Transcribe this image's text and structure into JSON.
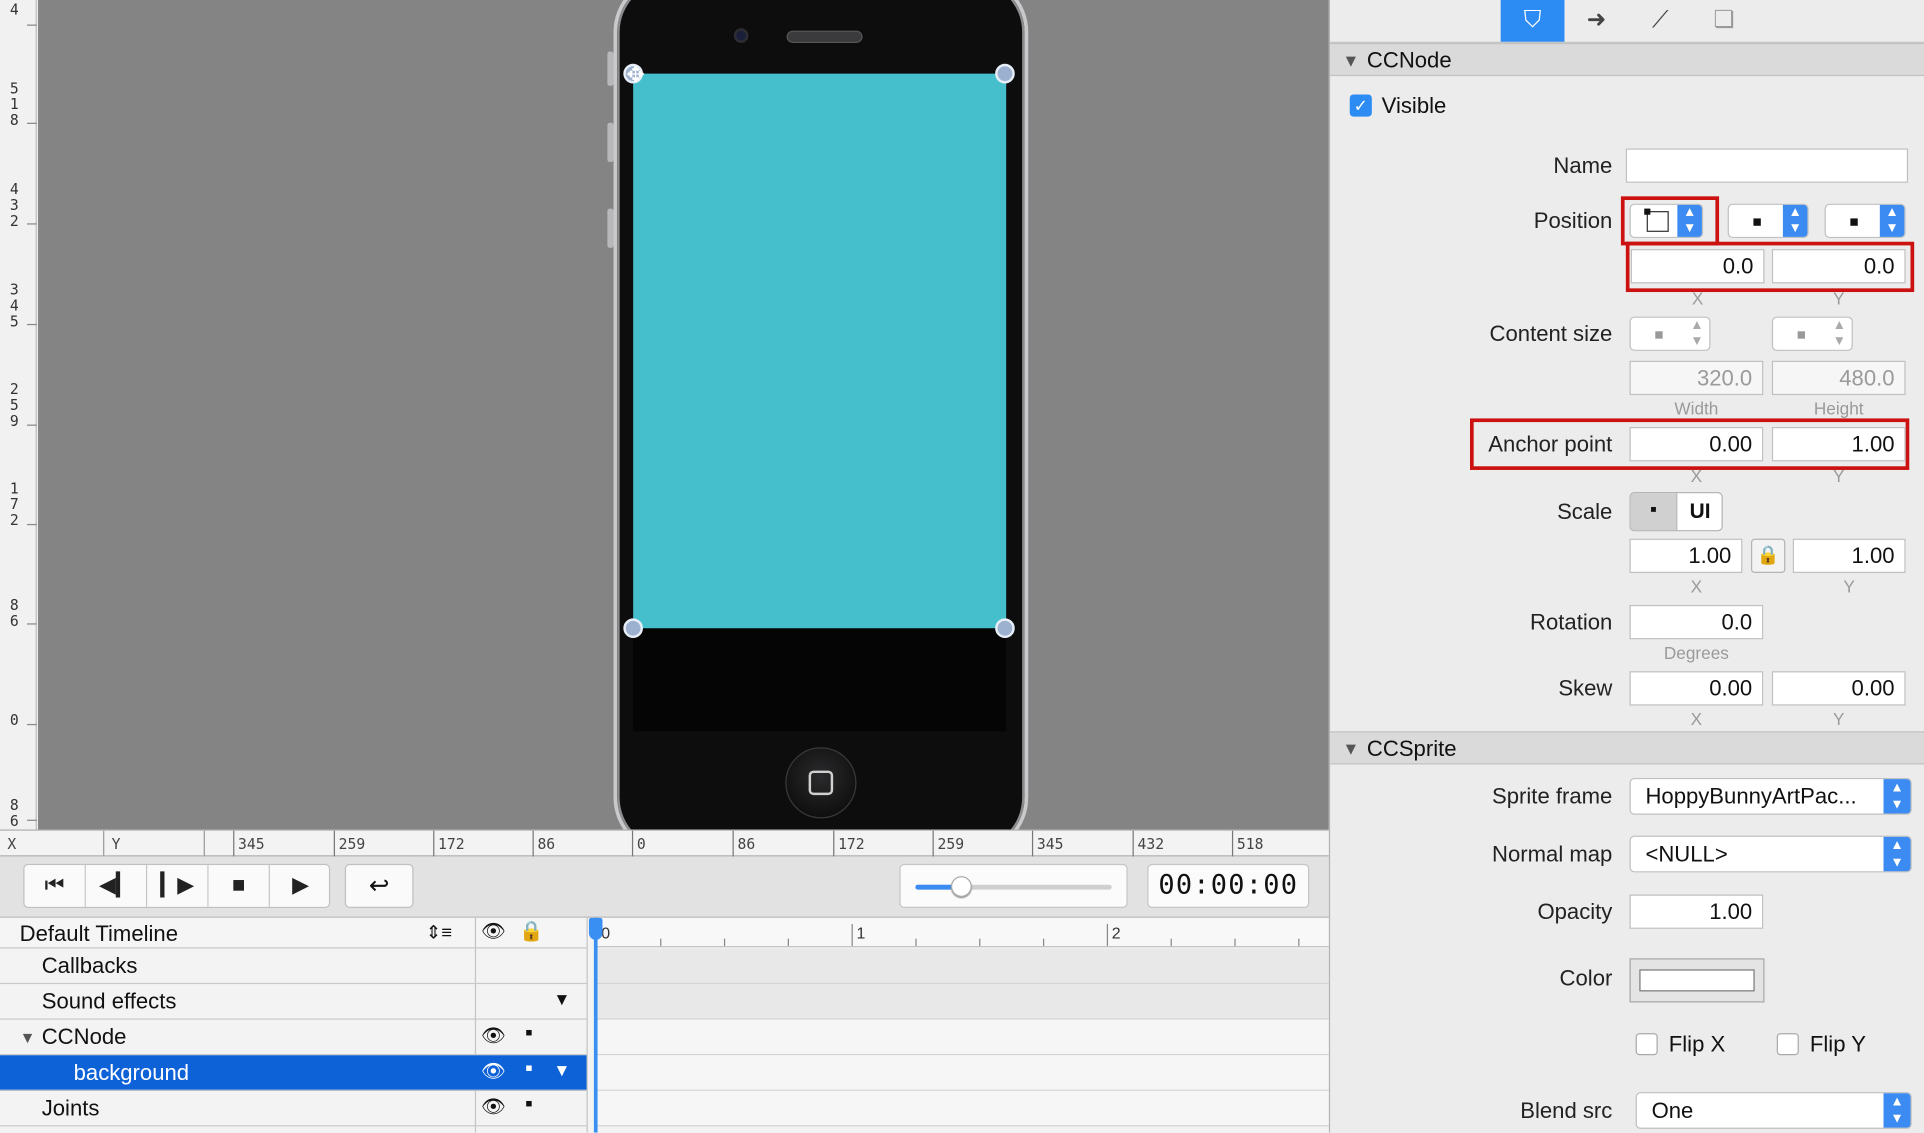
{
  "rulers": {
    "vertical_labels": [
      "4",
      "5\n1\n8",
      "4\n3\n2",
      "3\n4\n5",
      "2\n5\n9",
      "1\n7\n2",
      "8\n6",
      "0",
      "8\n6"
    ],
    "horizontal": {
      "x_label": "X",
      "y_label": "Y",
      "ticks": [
        "345",
        "259",
        "172",
        "86",
        "0",
        "86",
        "172",
        "259",
        "345",
        "432",
        "518"
      ]
    }
  },
  "transport": {
    "buttons": {
      "first": "⏮",
      "prev": "◀▎",
      "next": "▎▶",
      "stop": "■",
      "play": "▶",
      "loop": "↩"
    },
    "time": "00:00:00",
    "zoom_level": 0.23
  },
  "timeline": {
    "name": "Default Timeline",
    "ruler_ticks": [
      "0",
      "1",
      "2"
    ],
    "rows": [
      {
        "label": "Callbacks"
      },
      {
        "label": "Sound effects"
      },
      {
        "label": "CCNode"
      },
      {
        "label": "background"
      },
      {
        "label": "Joints"
      }
    ]
  },
  "inspector": {
    "tabs": [
      "node-properties",
      "code-connections",
      "physics",
      "templates"
    ],
    "ccnode": {
      "title": "CCNode",
      "visible_label": "Visible",
      "visible_checked": true,
      "name_label": "Name",
      "name_value": "",
      "position_label": "Position",
      "position_x": "0.0",
      "position_y": "0.0",
      "x_sub": "X",
      "y_sub": "Y",
      "content_size_label": "Content size",
      "width": "320.0",
      "height": "480.0",
      "width_sub": "Width",
      "height_sub": "Height",
      "anchor_label": "Anchor point",
      "anchor_x": "0.00",
      "anchor_y": "1.00",
      "scale_label": "Scale",
      "scale_mode_ui": "UI",
      "scale_x": "1.00",
      "scale_y": "1.00",
      "rotation_label": "Rotation",
      "rotation": "0.0",
      "degrees_sub": "Degrees",
      "skew_label": "Skew",
      "skew_x": "0.00",
      "skew_y": "0.00"
    },
    "ccsprite": {
      "title": "CCSprite",
      "sprite_frame_label": "Sprite frame",
      "sprite_frame_value": "HoppyBunnyArtPac...",
      "normal_map_label": "Normal map",
      "normal_map_value": "<NULL>",
      "opacity_label": "Opacity",
      "opacity": "1.00",
      "color_label": "Color",
      "color_value": "#ffffff",
      "flip_x_label": "Flip X",
      "flip_y_label": "Flip Y",
      "blend_src_label": "Blend src",
      "blend_src_value": "One"
    }
  },
  "colors": {
    "accent": "#2c8cf4",
    "screen_fill": "#45bfcb",
    "highlight_box": "#cc1111",
    "stage": "#848484"
  }
}
